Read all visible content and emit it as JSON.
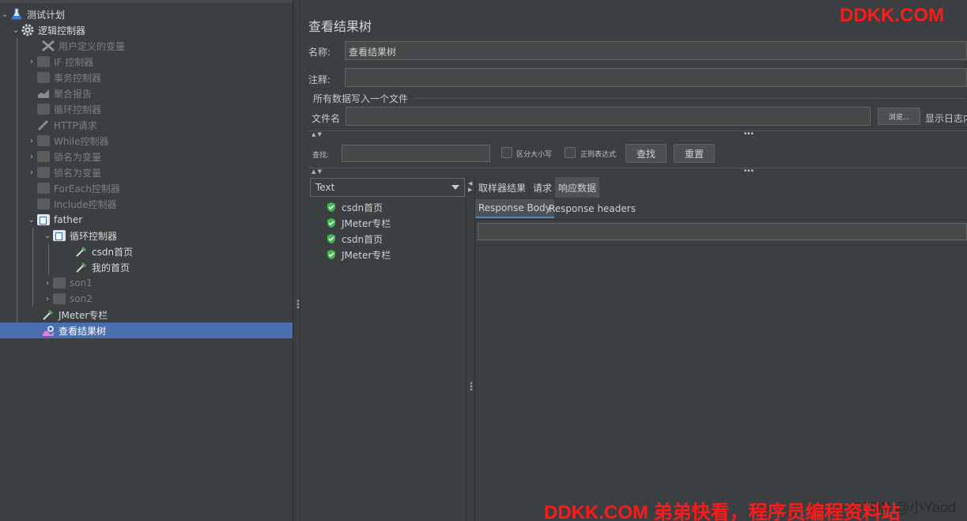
{
  "tree": {
    "items": [
      {
        "label": "测试计划",
        "icon": "flask-icon",
        "state": "active"
      },
      {
        "label": "逻辑控制器",
        "icon": "gear-icon",
        "state": "active"
      },
      {
        "label": "用户定义的变量",
        "icon": "wrench-icon",
        "state": "disabled"
      },
      {
        "label": "IF 控制器",
        "icon": "controller-box-icon",
        "state": "disabled"
      },
      {
        "label": "事务控制器",
        "icon": "controller-box-icon",
        "state": "disabled"
      },
      {
        "label": "聚合报告",
        "icon": "chart-icon",
        "state": "disabled"
      },
      {
        "label": "循环控制器",
        "icon": "controller-box-icon",
        "state": "disabled"
      },
      {
        "label": "HTTP请求",
        "icon": "pipette-icon",
        "state": "disabled"
      },
      {
        "label": "While控制器",
        "icon": "controller-box-icon",
        "state": "disabled"
      },
      {
        "label": "锁名为变量",
        "icon": "controller-box-icon",
        "state": "disabled"
      },
      {
        "label": "锁名为变量",
        "icon": "controller-box-icon",
        "state": "disabled"
      },
      {
        "label": "ForEach控制器",
        "icon": "controller-box-icon",
        "state": "disabled"
      },
      {
        "label": "Include控制器",
        "icon": "controller-box-icon",
        "state": "disabled"
      },
      {
        "label": "father",
        "icon": "controller-box-icon",
        "state": "active"
      },
      {
        "label": "循环控制器",
        "icon": "controller-box-icon",
        "state": "active"
      },
      {
        "label": "csdn首页",
        "icon": "pipette-icon",
        "state": "active"
      },
      {
        "label": "我的首页",
        "icon": "pipette-icon",
        "state": "active"
      },
      {
        "label": "son1",
        "icon": "controller-box-icon",
        "state": "disabled"
      },
      {
        "label": "son2",
        "icon": "controller-box-icon",
        "state": "disabled"
      },
      {
        "label": "JMeter专栏",
        "icon": "pipette-icon",
        "state": "active"
      },
      {
        "label": "查看结果树",
        "icon": "listener-icon",
        "state": "selected"
      }
    ]
  },
  "panel": {
    "title": "查看结果树",
    "name_label": "名称:",
    "name_value": "查看结果树",
    "comment_label": "注释:",
    "comment_value": "",
    "file_group_title": "所有数据写入一个文件",
    "filename_label": "文件名",
    "filename_value": "",
    "browse_button": "浏览...",
    "show_log_label": "显示日志内",
    "search_label": "查找:",
    "search_value": "",
    "case_sensitive_label": "区分大小写",
    "regex_label": "正则表达式",
    "find_button": "查找",
    "reset_button": "重置"
  },
  "results": {
    "renderer": "Text",
    "samples": [
      "csdn首页",
      "JMeter专栏",
      "csdn首页",
      "JMeter专栏"
    ],
    "status_color": "#3fb950"
  },
  "detail": {
    "tabs": [
      "取样器结果",
      "请求",
      "响应数据"
    ],
    "active_tab": "响应数据",
    "subtabs": [
      "Response Body",
      "Response headers"
    ],
    "active_subtab": "Response Body"
  },
  "watermark": {
    "top": "DDKK.COM",
    "bottom": "DDKK.COM 弟弟快看，程序员编程资料站",
    "csdn": "CSDN @小Yaod"
  },
  "colors": {
    "background": "#3c3f41",
    "selection": "#4b6eaf",
    "watermark": "#ff1a1a"
  }
}
